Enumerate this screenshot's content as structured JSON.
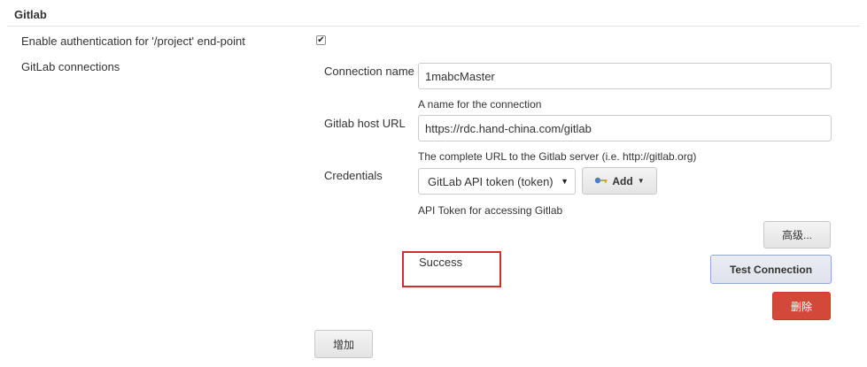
{
  "section": {
    "title": "Gitlab"
  },
  "auth": {
    "label": "Enable authentication for '/project' end-point",
    "checked": true,
    "check_glyph": "✔"
  },
  "connections": {
    "label": "GitLab connections",
    "connection_name": {
      "label": "Connection name",
      "value": "1mabcMaster",
      "help": "A name for the connection"
    },
    "host_url": {
      "label": "Gitlab host URL",
      "value": "https://rdc.hand-china.com/gitlab",
      "help": "The complete URL to the Gitlab server (i.e. http://gitlab.org)"
    },
    "credentials": {
      "label": "Credentials",
      "selected": "GitLab API token (token)",
      "add_label": "Add",
      "help": "API Token for accessing Gitlab"
    },
    "advanced_label": "高级...",
    "test_status": "Success",
    "test_button": "Test Connection",
    "delete_button": "删除",
    "add_connection_button": "增加"
  },
  "colors": {
    "delete_button_bg": "#d24939",
    "status_border": "#d32d2d",
    "test_button_border": "#8fa9d8"
  },
  "icons": {
    "credentials_add": "key-icon",
    "dropdown": "caret-down-icon"
  }
}
